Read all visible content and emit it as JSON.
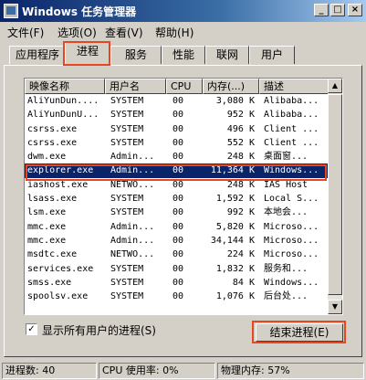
{
  "window": {
    "title": "Windows 任务管理器",
    "controls": {
      "minimize": "_",
      "maximize": "□",
      "close": "×"
    }
  },
  "menubar": [
    "文件(F)",
    "选项(O)",
    "查看(V)",
    "帮助(H)"
  ],
  "tabs": [
    "应用程序",
    "进程",
    "服务",
    "性能",
    "联网",
    "用户"
  ],
  "active_tab": "进程",
  "process_table": {
    "columns": [
      "映像名称",
      "用户名",
      "CPU",
      "内存(...)",
      "描述"
    ],
    "rows": [
      {
        "name": "AliYunDun....",
        "user": "SYSTEM",
        "cpu": "00",
        "mem": "3,080 K",
        "desc": "Alibaba..."
      },
      {
        "name": "AliYunDunU...",
        "user": "SYSTEM",
        "cpu": "00",
        "mem": "952 K",
        "desc": "Alibaba..."
      },
      {
        "name": "csrss.exe",
        "user": "SYSTEM",
        "cpu": "00",
        "mem": "496 K",
        "desc": "Client ..."
      },
      {
        "name": "csrss.exe",
        "user": "SYSTEM",
        "cpu": "00",
        "mem": "552 K",
        "desc": "Client ..."
      },
      {
        "name": "dwm.exe",
        "user": "Admin...",
        "cpu": "00",
        "mem": "248 K",
        "desc": "桌面窗..."
      },
      {
        "name": "explorer.exe",
        "user": "Admin...",
        "cpu": "00",
        "mem": "11,364 K",
        "desc": "Windows..."
      },
      {
        "name": "iashost.exe",
        "user": "NETWO...",
        "cpu": "00",
        "mem": "248 K",
        "desc": "IAS Host"
      },
      {
        "name": "lsass.exe",
        "user": "SYSTEM",
        "cpu": "00",
        "mem": "1,592 K",
        "desc": "Local S..."
      },
      {
        "name": "lsm.exe",
        "user": "SYSTEM",
        "cpu": "00",
        "mem": "992 K",
        "desc": "本地会..."
      },
      {
        "name": "mmc.exe",
        "user": "Admin...",
        "cpu": "00",
        "mem": "5,820 K",
        "desc": "Microso..."
      },
      {
        "name": "mmc.exe",
        "user": "Admin...",
        "cpu": "00",
        "mem": "34,144 K",
        "desc": "Microso..."
      },
      {
        "name": "msdtc.exe",
        "user": "NETWO...",
        "cpu": "00",
        "mem": "224 K",
        "desc": "Microso..."
      },
      {
        "name": "services.exe",
        "user": "SYSTEM",
        "cpu": "00",
        "mem": "1,832 K",
        "desc": "服务和..."
      },
      {
        "name": "smss.exe",
        "user": "SYSTEM",
        "cpu": "00",
        "mem": "84 K",
        "desc": "Windows..."
      },
      {
        "name": "spoolsv.exe",
        "user": "SYSTEM",
        "cpu": "00",
        "mem": "1,076 K",
        "desc": "后台处..."
      }
    ],
    "selected_row": "explorer.exe"
  },
  "show_all_users": {
    "checked": true,
    "mark": "✓",
    "label": "显示所有用户的进程(S)"
  },
  "end_process_button": "结束进程(E)",
  "statusbar": {
    "processes": "进程数: 40",
    "cpu": "CPU 使用率: 0%",
    "memory": "物理内存: 57%"
  },
  "highlight_color": "#e8461e",
  "selection_color": "#0a246a"
}
